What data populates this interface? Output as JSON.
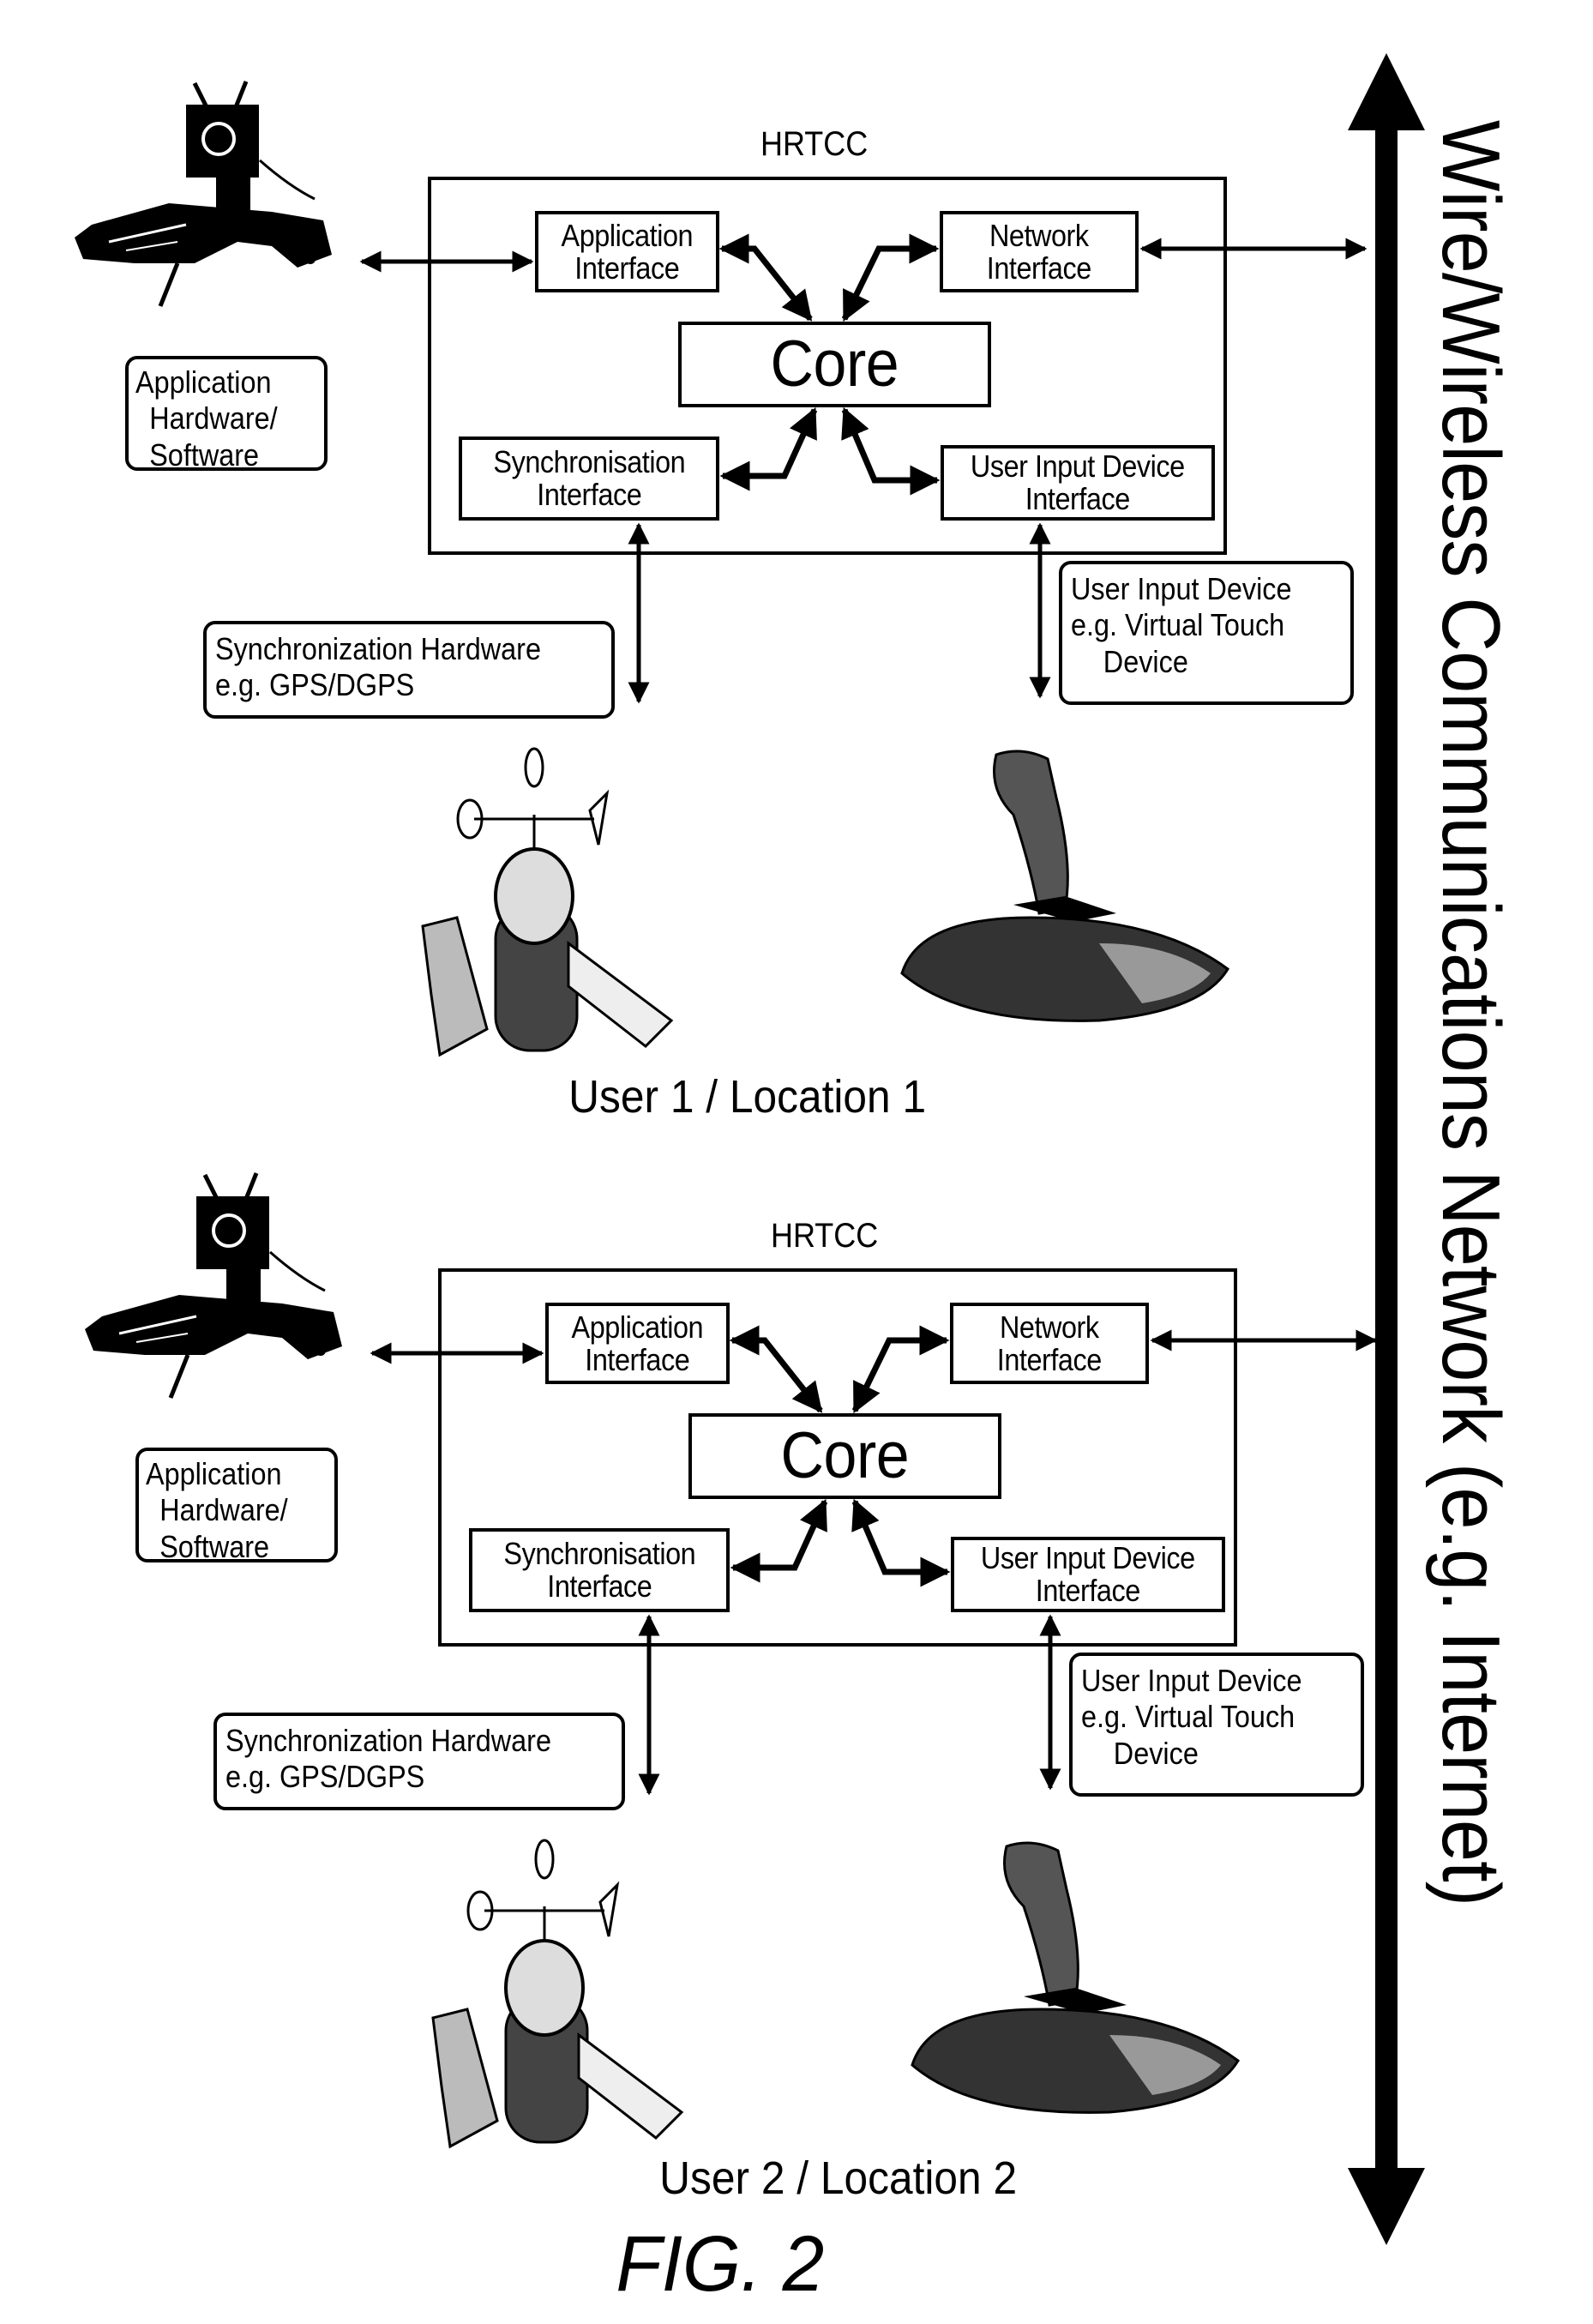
{
  "figure": {
    "caption": "FIG. 2",
    "network_label": "Wire/Wireless Communications Network (e.g. Internet)"
  },
  "sections": [
    {
      "location_label": "User 1 / Location 1",
      "hrtcc": {
        "title": "HRTCC",
        "core": "Core",
        "application_interface": [
          "Application",
          "Interface"
        ],
        "network_interface": [
          "Network",
          "Interface"
        ],
        "synchronisation_interface": [
          "Synchronisation",
          "Interface"
        ],
        "user_input_device_interface": [
          "User Input Device",
          "Interface"
        ]
      },
      "callouts": {
        "application_hw_sw": [
          "Application",
          "Hardware/",
          "Software"
        ],
        "synchronization_hardware": [
          "Synchronization Hardware",
          "e.g. GPS/DGPS"
        ],
        "user_input_device": [
          "User Input Device",
          "e.g. Virtual Touch",
          "Device"
        ]
      },
      "images": {
        "application": "robot-arm-illustration",
        "synchronization": "weather-station-gps-illustration",
        "user_input": "joystick-illustration"
      }
    },
    {
      "location_label": "User 2 / Location 2",
      "hrtcc": {
        "title": "HRTCC",
        "core": "Core",
        "application_interface": [
          "Application",
          "Interface"
        ],
        "network_interface": [
          "Network",
          "Interface"
        ],
        "synchronisation_interface": [
          "Synchronisation",
          "Interface"
        ],
        "user_input_device_interface": [
          "User Input Device",
          "Interface"
        ]
      },
      "callouts": {
        "application_hw_sw": [
          "Application",
          "Hardware/",
          "Software"
        ],
        "synchronization_hardware": [
          "Synchronization Hardware",
          "e.g. GPS/DGPS"
        ],
        "user_input_device": [
          "User Input Device",
          "e.g. Virtual Touch",
          "Device"
        ]
      },
      "images": {
        "application": "robot-arm-illustration",
        "synchronization": "weather-station-gps-illustration",
        "user_input": "joystick-illustration"
      }
    }
  ]
}
